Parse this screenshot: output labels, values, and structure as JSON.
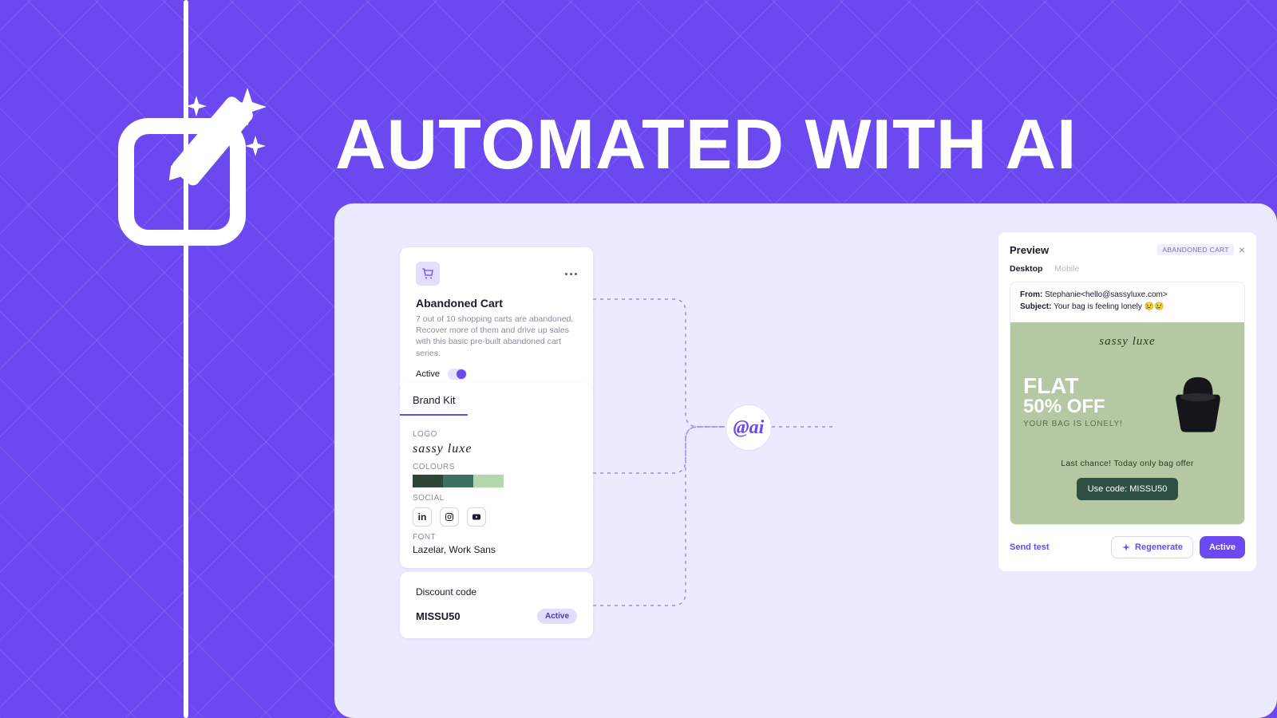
{
  "headline": "AUTOMATED WITH AI",
  "abandoned": {
    "title": "Abandoned Cart",
    "description": "7 out of 10 shopping carts are abandoned. Recover more of them and drive up sales with this basic pre-built abandoned cart series.",
    "active_label": "Active"
  },
  "brand_kit": {
    "tab": "Brand Kit",
    "logo_label": "LOGO",
    "logo_text": "sassy luxe",
    "colours_label": "COLOURS",
    "colours": [
      "#2f4538",
      "#3f6f62",
      "#b5d5ad"
    ],
    "social_label": "SOCIAL",
    "font_label": "FONT",
    "font_value": "Lazelar, Work Sans"
  },
  "discount": {
    "title": "Discount code",
    "code": "MISSU50",
    "status": "Active"
  },
  "ai_badge": "ai",
  "preview": {
    "title": "Preview",
    "tag": "ABANDONED CART",
    "tab_desktop": "Desktop",
    "tab_mobile": "Mobile",
    "from_label": "From:",
    "from_value": "Stephanie<hello@sassyluxe.com>",
    "subject_label": "Subject:",
    "subject_value": "Your bag is feeling lonely 😢😢",
    "hero_logo": "sassy luxe",
    "flat": "FLAT",
    "off": "50% OFF",
    "lonely": "YOUR BAG IS LONELY!",
    "chance": "Last chance! Today only bag offer",
    "code_btn": "Use code: MISSU50",
    "send_test": "Send test",
    "regenerate": "Regenerate",
    "active_btn": "Active"
  }
}
